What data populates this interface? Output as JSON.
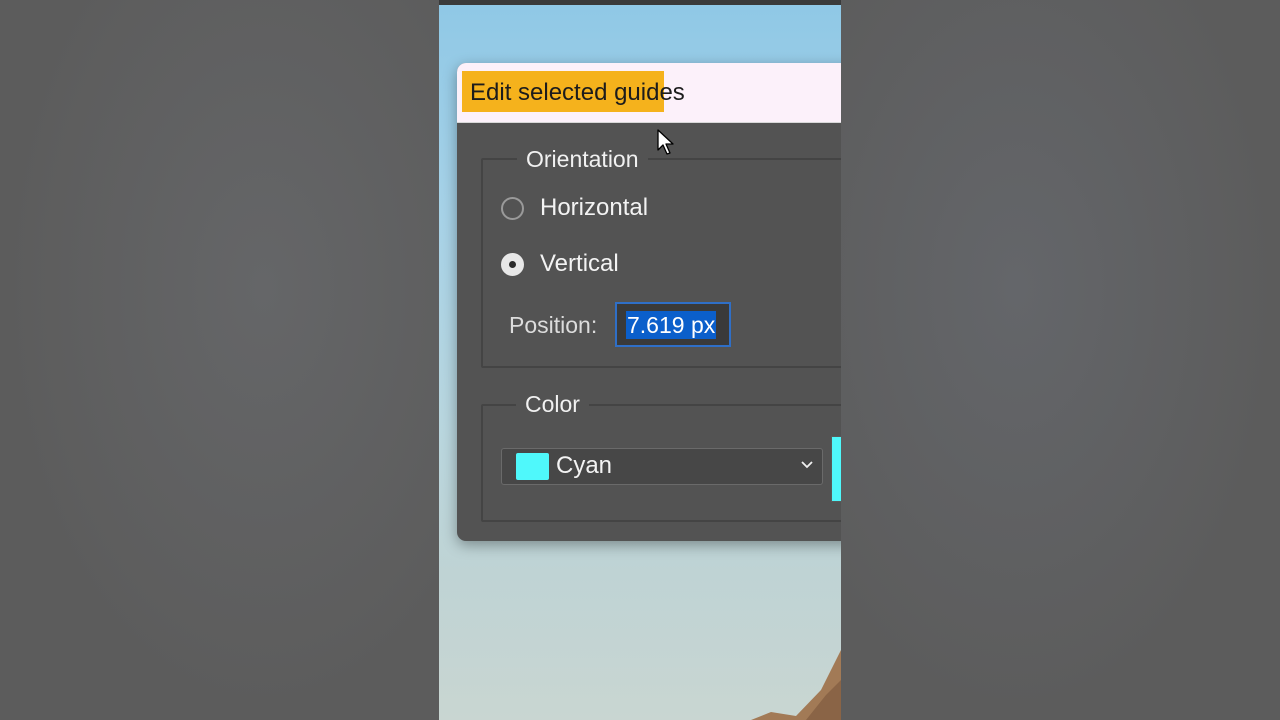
{
  "dialog": {
    "title": "Edit selected guides",
    "orientation": {
      "legend": "Orientation",
      "options": [
        {
          "label": "Horizontal",
          "checked": false
        },
        {
          "label": "Vertical",
          "checked": true
        }
      ]
    },
    "position": {
      "label": "Position:",
      "value": "7.619 px"
    },
    "color": {
      "legend": "Color",
      "selected": "Cyan",
      "swatch_hex": "#4ff8fb"
    }
  },
  "colors": {
    "title_highlight": "#f5b21c",
    "dialog_bg": "#535353",
    "selection_blue": "#0b5fcb",
    "cyan": "#4ff8fb"
  },
  "icons": [
    "mouse-cursor-icon",
    "chevron-down-icon"
  ]
}
